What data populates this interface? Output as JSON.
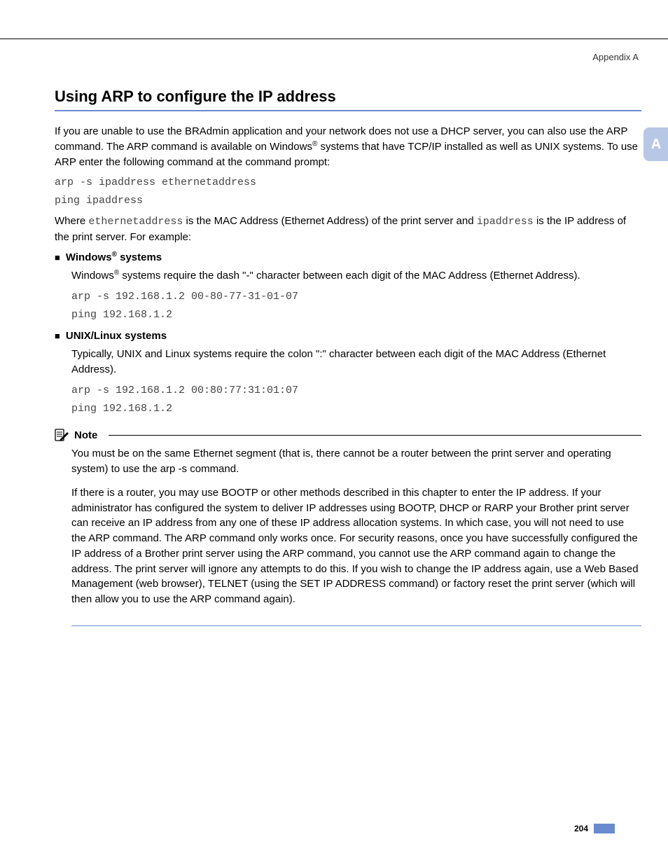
{
  "header": {
    "appendix": "Appendix A"
  },
  "side_tab": "A",
  "heading": "Using ARP to configure the IP address",
  "intro": {
    "p1a": "If you are unable to use the BRAdmin application and your network does not use a DHCP server, you can also use the ARP command. The ARP command is available on Windows",
    "reg1": "®",
    "p1b": " systems that have TCP/IP installed as well as UNIX systems. To use ARP enter the following command at the command prompt:"
  },
  "cmd_generic": "arp -s ipaddress ethernetaddress\nping ipaddress",
  "where": {
    "a": "Where ",
    "ethaddr": "ethernetaddress",
    "b": " is the MAC Address (Ethernet Address) of the print server and ",
    "ipaddr": "ipaddress",
    "c": " is the IP address of the print server. For example:"
  },
  "windows": {
    "title_a": "Windows",
    "title_reg": "®",
    "title_b": " systems",
    "para_a": "Windows",
    "para_reg": "®",
    "para_b": " systems require the dash \"-\" character between each digit of the MAC Address (Ethernet Address).",
    "cmd": "arp -s 192.168.1.2 00-80-77-31-01-07\nping 192.168.1.2"
  },
  "unix": {
    "title": "UNIX/Linux systems",
    "para": "Typically, UNIX and Linux systems require the colon \":\" character between each digit of the MAC Address (Ethernet Address).",
    "cmd": "arp -s 192.168.1.2 00:80:77:31:01:07\nping 192.168.1.2"
  },
  "note": {
    "label": "Note",
    "p1": "You must be on the same Ethernet segment (that is, there cannot be a router between the print server and operating system) to use the arp -s command.",
    "p2": "If there is a router, you may use BOOTP or other methods described in this chapter to enter the IP address. If your administrator has configured the system to deliver IP addresses using BOOTP, DHCP or RARP your Brother print server can receive an IP address from any one of these IP address allocation systems. In which case, you will not need to use the ARP command. The ARP command only works once. For security reasons, once you have successfully configured the IP address of a Brother print server using the ARP command, you cannot use the ARP command again to change the address. The print server will ignore any attempts to do this. If you wish to change the IP address again, use a Web Based Management (web browser), TELNET (using the SET IP ADDRESS command) or factory reset the print server (which will then allow you to use the ARP command again)."
  },
  "page_number": "204"
}
